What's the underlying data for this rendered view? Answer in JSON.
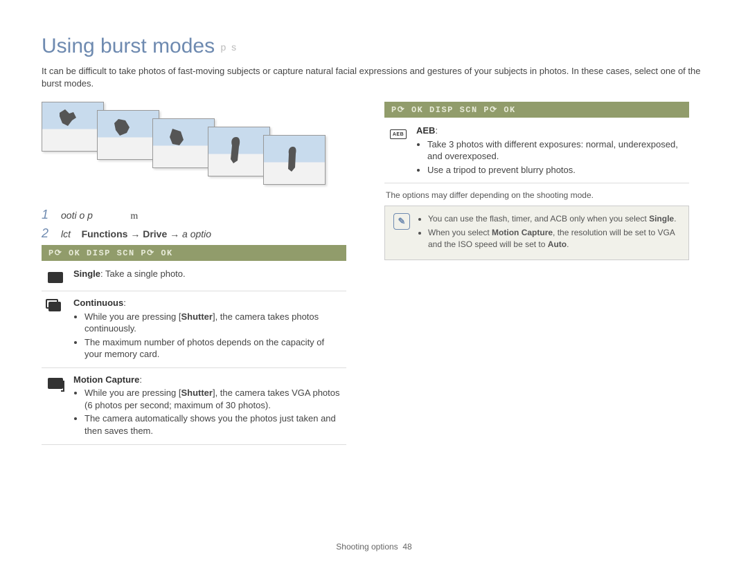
{
  "title": "Using burst modes",
  "title_mode_icons": "p s",
  "intro": "It can be difficult to take photos of fast-moving subjects or capture natural facial expressions and gestures of your subjects in photos. In these cases, select one of the burst modes.",
  "steps": [
    {
      "num": "1",
      "prefix": "ooti o p",
      "suffix_m": "m"
    },
    {
      "num": "2",
      "prefix": "lct",
      "bold": "Functions → Drive →",
      "suffix_italic": "a optio"
    }
  ],
  "statusbar_text": "P⟳ OK  DISP SCN  P⟳ OK",
  "left_options": [
    {
      "icon": "single",
      "label": "Single",
      "after_label": ": Take a single photo.",
      "bullets": []
    },
    {
      "icon": "cont",
      "label": "Continuous",
      "after_label": ":",
      "bullets": [
        {
          "pre": "While you are pressing [",
          "bold": "Shutter",
          "post": "], the camera takes photos continuously."
        },
        {
          "pre": "The maximum number of photos depends on the capacity of your memory card.",
          "bold": "",
          "post": ""
        }
      ]
    },
    {
      "icon": "motion",
      "label": "Motion Capture",
      "after_label": ":",
      "bullets": [
        {
          "pre": "While you are pressing [",
          "bold": "Shutter",
          "post": "], the camera takes VGA photos (6 photos per second; maximum of 30 photos)."
        },
        {
          "pre": "The camera automatically shows you the photos just taken and then saves them.",
          "bold": "",
          "post": ""
        }
      ]
    }
  ],
  "right_options": [
    {
      "icon": "aeb",
      "icon_text": "AEB",
      "label": "AEB",
      "after_label": ":",
      "bullets": [
        {
          "pre": "Take 3 photos with different exposures: normal, underexposed, and overexposed.",
          "bold": "",
          "post": ""
        },
        {
          "pre": "Use a tripod to prevent blurry photos.",
          "bold": "",
          "post": ""
        }
      ]
    }
  ],
  "note": "The options may differ depending on the shooting mode.",
  "info": {
    "icon_text": "✎",
    "items": [
      {
        "pre": "You can use the flash, timer, and ACB only when you select ",
        "bold": "Single",
        "post": "."
      },
      {
        "pre": "When you select ",
        "bold": "Motion Capture",
        "post_pre": ", the resolution will be set to VGA and the ISO speed will be set to ",
        "bold2": "Auto",
        "post": "."
      }
    ]
  },
  "footer": {
    "section": "Shooting options",
    "page": "48"
  }
}
